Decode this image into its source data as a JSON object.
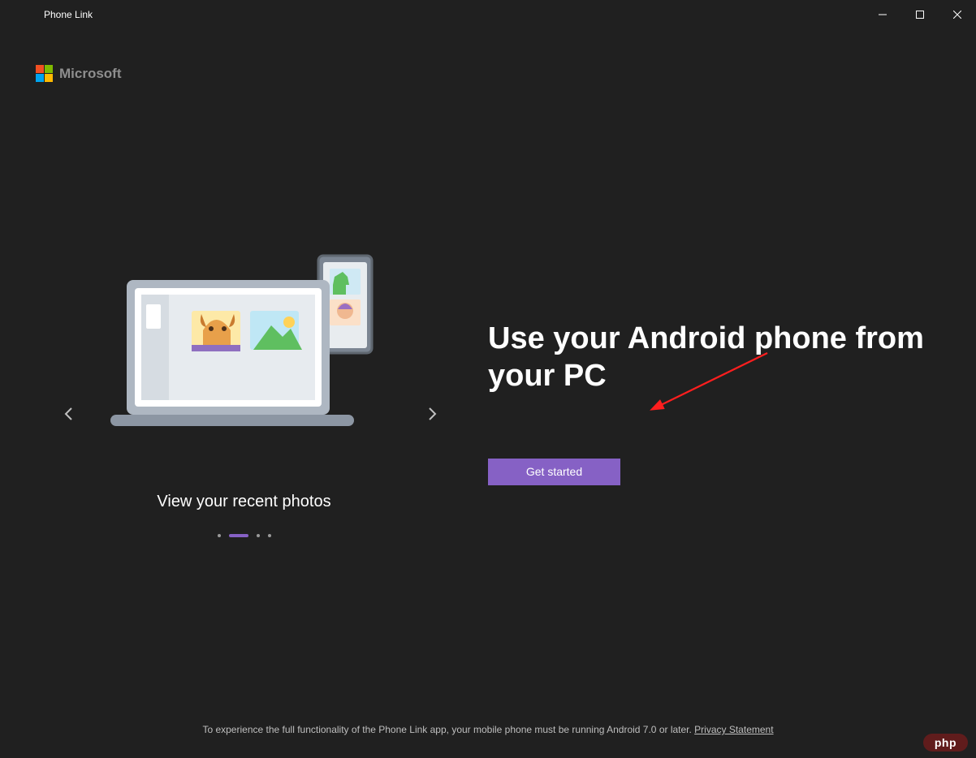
{
  "window": {
    "title": "Phone Link"
  },
  "brand": {
    "name": "Microsoft"
  },
  "carousel": {
    "caption": "View your recent photos",
    "active_index": 1,
    "total": 4
  },
  "main": {
    "heading": "Use your Android phone from your PC",
    "cta": "Get started"
  },
  "footer": {
    "text": "To experience the full functionality of the Phone Link app, your mobile phone must be running Android 7.0 or later. ",
    "link_text": "Privacy Statement"
  },
  "watermark": {
    "text": "php"
  }
}
